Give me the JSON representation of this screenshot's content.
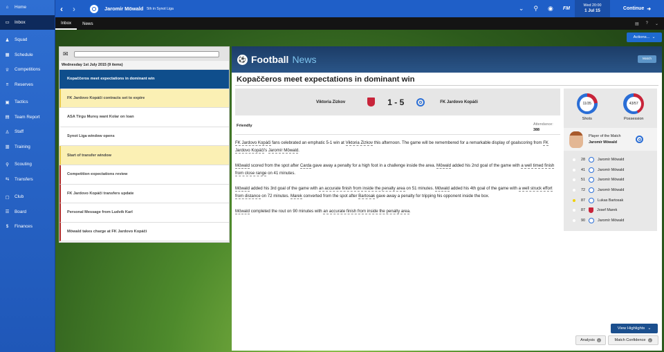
{
  "sidebar": {
    "items": [
      {
        "label": "Home",
        "icon": "home-icon"
      },
      {
        "label": "Inbox",
        "icon": "inbox-icon",
        "active": true
      },
      {
        "label": "Squad",
        "icon": "squad-icon"
      },
      {
        "label": "Schedule",
        "icon": "schedule-icon"
      },
      {
        "label": "Competitions",
        "icon": "trophy-icon"
      },
      {
        "label": "Reserves",
        "icon": "reserves-icon"
      },
      {
        "label": "Tactics",
        "icon": "tactics-icon"
      },
      {
        "label": "Team Report",
        "icon": "report-icon"
      },
      {
        "label": "Staff",
        "icon": "staff-icon"
      },
      {
        "label": "Training",
        "icon": "training-icon"
      },
      {
        "label": "Scouting",
        "icon": "scouting-icon"
      },
      {
        "label": "Transfers",
        "icon": "transfers-icon"
      },
      {
        "label": "Club",
        "icon": "club-icon"
      },
      {
        "label": "Board",
        "icon": "board-icon"
      },
      {
        "label": "Finances",
        "icon": "finances-icon"
      }
    ]
  },
  "topbar": {
    "manager": "Jaromír Möwald",
    "subtitle": "5th in Synot Liga",
    "fm_label": "FM",
    "date_day": "Wed 20:00",
    "date": "1 Jul 15",
    "continue_label": "Continue"
  },
  "subbar": {
    "tabs": [
      "Inbox",
      "News"
    ]
  },
  "actions_label": "Actions...",
  "inbox": {
    "date_header": "Wednesday 1st July 2015 (9 items)",
    "messages": [
      {
        "title": "Kopaččeros meet expectations in dominant win",
        "state": "selected"
      },
      {
        "title": "FK Jardovo Kopáči contracts set to expire",
        "state": "yellow"
      },
      {
        "title": "ASA Tirgu Mureş want Kolar on loan",
        "state": ""
      },
      {
        "title": "Synot Liga window opens",
        "state": ""
      },
      {
        "title": "Start of transfer window",
        "state": "yellow"
      },
      {
        "title": "Competition expectations review",
        "state": "red"
      },
      {
        "title": "FK Jardovo Kopáči transfers update",
        "state": "red"
      },
      {
        "title": "Personal Message from Ludvík Karl",
        "state": "red"
      },
      {
        "title": "Möwald takes charge at FK Jardovo Kopáči",
        "state": "red"
      }
    ]
  },
  "news": {
    "brand_a": "Football",
    "brand_b": "News",
    "match_btn": "Match",
    "headline": "Kopaččeros meet expectations in dominant win",
    "home_team": "Viktoria Zizkov",
    "away_team": "FK Jardovo Kopáči",
    "score": "1 - 5",
    "competition": "Friendly",
    "attendance_label": "Attendance:",
    "attendance": "388"
  },
  "stats": {
    "shots_label": "Shots",
    "shots_value": "11/35",
    "possession_label": "Possession",
    "possession_value": "43/57",
    "potm_label": "Player of the Match",
    "potm_name": "Jaromír Möwald",
    "colors": {
      "home": "#c8243a",
      "away": "#2a6ed6"
    },
    "shots_home_fraction": 0.24,
    "possession_home_fraction": 0.43,
    "goals": [
      {
        "min": "28",
        "player": "Jaromír Möwald",
        "team": "away",
        "card": false
      },
      {
        "min": "41",
        "player": "Jaromír Möwald",
        "team": "away",
        "card": false
      },
      {
        "min": "51",
        "player": "Jaromír Möwald",
        "team": "away",
        "card": false
      },
      {
        "min": "72",
        "player": "Jaromír Möwald",
        "team": "away",
        "card": false
      },
      {
        "min": "87",
        "player": "Lukas Bartosak",
        "team": "away",
        "card": true
      },
      {
        "min": "87",
        "player": "Josef Marek",
        "team": "home",
        "card": false
      },
      {
        "min": "90",
        "player": "Jaromír Möwald",
        "team": "away",
        "card": false
      }
    ]
  },
  "buttons": {
    "view_highlights": "View Highlights",
    "analysis": "Analysis",
    "match_confidence": "Match Confidence"
  }
}
